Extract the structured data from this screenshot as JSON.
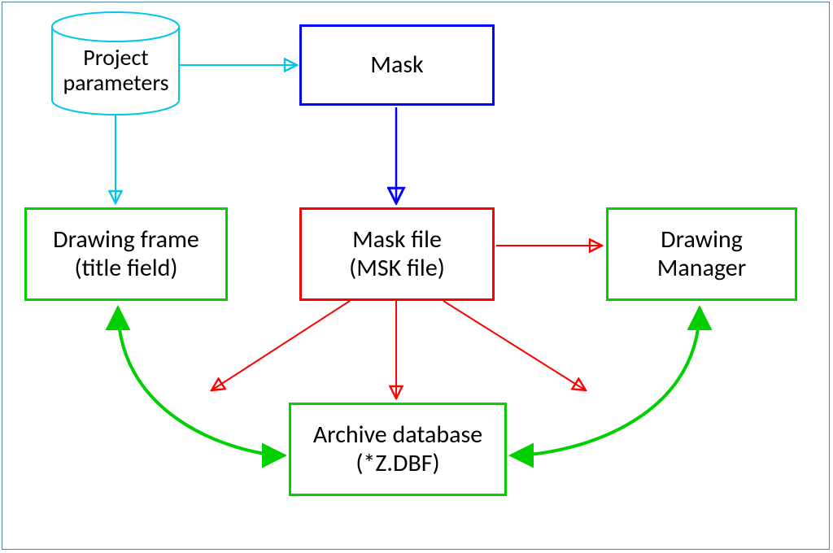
{
  "colors": {
    "frame": "#4a7ebb",
    "cyan": "#00c8e8",
    "blue": "#0000ff",
    "red": "#ff0000",
    "green": "#00d000"
  },
  "nodes": {
    "project_parameters": {
      "line1": "Project",
      "line2": "parameters"
    },
    "mask": {
      "label": "Mask"
    },
    "drawing_frame": {
      "line1": "Drawing frame",
      "line2": "(title field)"
    },
    "mask_file": {
      "line1": "Mask file",
      "line2": "(MSK file)"
    },
    "drawing_manager": {
      "line1": "Drawing",
      "line2": "Manager"
    },
    "archive_db": {
      "line1": "Archive database",
      "line2": "(*Z.DBF)"
    }
  },
  "edges": [
    {
      "from": "project_parameters",
      "to": "mask",
      "color": "cyan",
      "style": "arrow"
    },
    {
      "from": "project_parameters",
      "to": "drawing_frame",
      "color": "cyan",
      "style": "arrow"
    },
    {
      "from": "mask",
      "to": "mask_file",
      "color": "blue",
      "style": "arrow"
    },
    {
      "from": "mask_file",
      "to": "drawing_manager",
      "color": "red",
      "style": "arrow"
    },
    {
      "from": "mask_file",
      "to": "drawing_frame",
      "color": "red",
      "style": "arrow"
    },
    {
      "from": "mask_file",
      "to": "archive_db",
      "color": "red",
      "style": "arrow"
    },
    {
      "from": "mask_file",
      "to": "drawing_manager_area",
      "color": "red",
      "style": "arrow"
    },
    {
      "from": "drawing_frame",
      "to": "archive_db",
      "color": "green",
      "style": "bidir-curve"
    },
    {
      "from": "drawing_manager",
      "to": "archive_db",
      "color": "green",
      "style": "bidir-curve"
    }
  ]
}
